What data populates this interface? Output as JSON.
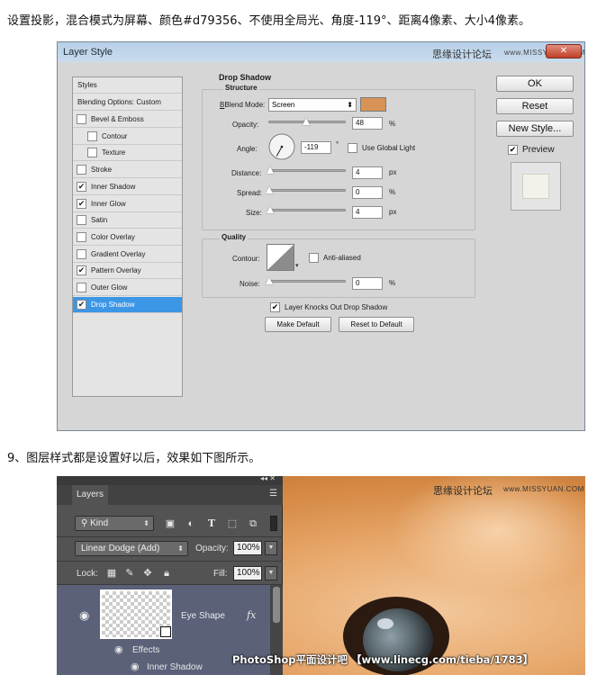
{
  "captions": {
    "step8": "设置投影，混合模式为屏幕、颜色#d79356、不使用全局光、角度-119°、距离4像素、大小4像素。",
    "step9": "9、图层样式都是设置好以后，效果如下图所示。"
  },
  "dialog": {
    "title": "Layer Style",
    "close": "✕",
    "watermark_cn": "思缘设计论坛",
    "watermark_url": "www.MISSYUAN.COM",
    "styles_header": "Styles",
    "blending_options": "Blending Options: Custom",
    "styles": [
      {
        "label": "Bevel & Emboss",
        "checked": false,
        "indent": false,
        "selected": false
      },
      {
        "label": "Contour",
        "checked": false,
        "indent": true,
        "selected": false
      },
      {
        "label": "Texture",
        "checked": false,
        "indent": true,
        "selected": false
      },
      {
        "label": "Stroke",
        "checked": false,
        "indent": false,
        "selected": false
      },
      {
        "label": "Inner Shadow",
        "checked": true,
        "indent": false,
        "selected": false
      },
      {
        "label": "Inner Glow",
        "checked": true,
        "indent": false,
        "selected": false
      },
      {
        "label": "Satin",
        "checked": false,
        "indent": false,
        "selected": false
      },
      {
        "label": "Color Overlay",
        "checked": false,
        "indent": false,
        "selected": false
      },
      {
        "label": "Gradient Overlay",
        "checked": false,
        "indent": false,
        "selected": false
      },
      {
        "label": "Pattern Overlay",
        "checked": true,
        "indent": false,
        "selected": false
      },
      {
        "label": "Outer Glow",
        "checked": false,
        "indent": false,
        "selected": false
      },
      {
        "label": "Drop Shadow",
        "checked": true,
        "indent": false,
        "selected": true
      }
    ],
    "drop_shadow": {
      "section_title": "Drop Shadow",
      "structure_title": "Structure",
      "blend_mode_label": "Blend Mode:",
      "blend_mode_value": "Screen",
      "color": "#d79356",
      "opacity_label": "Opacity:",
      "opacity_value": "48",
      "opacity_fraction": 0.48,
      "percent": "%",
      "angle_label": "Angle:",
      "angle_value": "-119",
      "degree": "°",
      "global_light_label": "Use Global Light",
      "global_light_checked": false,
      "distance_label": "Distance:",
      "distance_value": "4",
      "spread_label": "Spread:",
      "spread_value": "0",
      "size_label": "Size:",
      "size_value": "4",
      "px": "px",
      "quality_title": "Quality",
      "contour_label": "Contour:",
      "anti_aliased_label": "Anti-aliased",
      "anti_aliased_checked": false,
      "noise_label": "Noise:",
      "noise_value": "0",
      "knocks_out_label": "Layer Knocks Out Drop Shadow",
      "knocks_out_checked": true,
      "make_default": "Make Default",
      "reset_default": "Reset to Default"
    },
    "ok": "OK",
    "reset": "Reset",
    "new_style": "New Style...",
    "preview_label": "Preview",
    "preview_checked": true
  },
  "layers_panel": {
    "collapse": "◂◂ ✕",
    "tab_label": "Layers",
    "menu_icon": "☰",
    "kind_label": "Kind",
    "blend_mode": "Linear Dodge (Add)",
    "opacity_label": "Opacity:",
    "opacity_value": "100%",
    "lock_label": "Lock:",
    "fill_label": "Fill:",
    "fill_value": "100%",
    "layer_name": "Eye Shape",
    "fx": "fx",
    "effects_label": "Effects",
    "inner_shadow_label": "Inner Shadow"
  },
  "photo": {
    "watermark_cn": "思缘设计论坛",
    "watermark_url": "www.MISSYUAN.COM",
    "credit": "PhotoShop平面设计吧 【www.linecg.com/tieba/1783】"
  }
}
